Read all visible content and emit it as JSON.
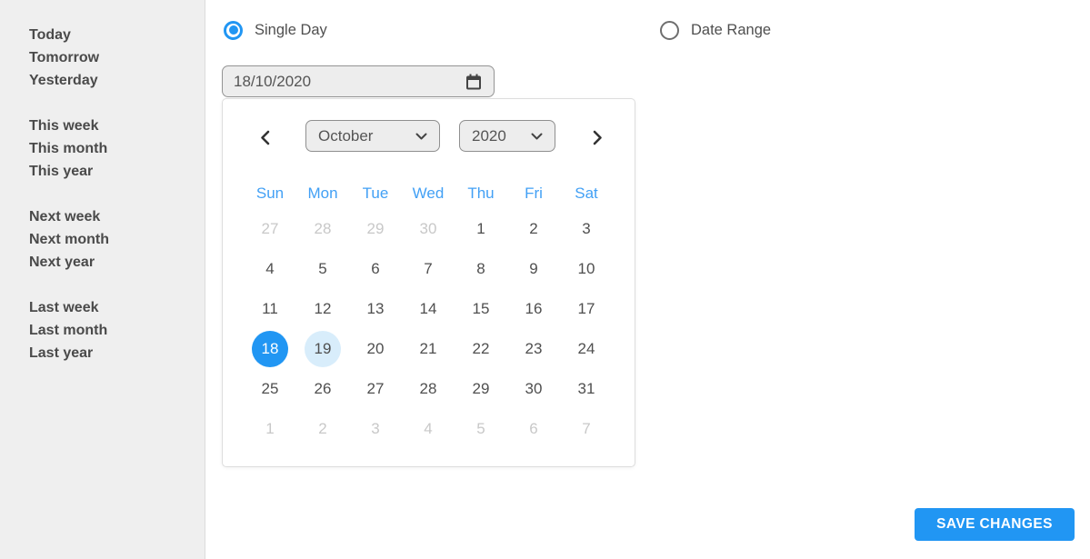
{
  "colors": {
    "accent": "#2196f3",
    "day_header": "#42a0f5",
    "highlight": "#d8edfb"
  },
  "sidebar": {
    "groups": [
      {
        "items": [
          {
            "label": "Today"
          },
          {
            "label": "Tomorrow"
          },
          {
            "label": "Yesterday"
          }
        ]
      },
      {
        "items": [
          {
            "label": "This week"
          },
          {
            "label": "This month"
          },
          {
            "label": "This year"
          }
        ]
      },
      {
        "items": [
          {
            "label": "Next week"
          },
          {
            "label": "Next month"
          },
          {
            "label": "Next year"
          }
        ]
      },
      {
        "items": [
          {
            "label": "Last week"
          },
          {
            "label": "Last month"
          },
          {
            "label": "Last year"
          }
        ]
      }
    ]
  },
  "mode": {
    "single_day": {
      "label": "Single Day",
      "selected": true
    },
    "date_range": {
      "label": "Date Range",
      "selected": false
    }
  },
  "date_field": {
    "value": "18/10/2020"
  },
  "calendar": {
    "month": "October",
    "year": "2020",
    "day_headers": [
      "Sun",
      "Mon",
      "Tue",
      "Wed",
      "Thu",
      "Fri",
      "Sat"
    ],
    "selected_day": 18,
    "highlighted_day": 19,
    "cells": [
      {
        "day": 27,
        "state": "muted"
      },
      {
        "day": 28,
        "state": "muted"
      },
      {
        "day": 29,
        "state": "muted"
      },
      {
        "day": 30,
        "state": "muted"
      },
      {
        "day": 1,
        "state": "normal"
      },
      {
        "day": 2,
        "state": "normal"
      },
      {
        "day": 3,
        "state": "normal"
      },
      {
        "day": 4,
        "state": "normal"
      },
      {
        "day": 5,
        "state": "normal"
      },
      {
        "day": 6,
        "state": "normal"
      },
      {
        "day": 7,
        "state": "normal"
      },
      {
        "day": 8,
        "state": "normal"
      },
      {
        "day": 9,
        "state": "normal"
      },
      {
        "day": 10,
        "state": "normal"
      },
      {
        "day": 11,
        "state": "normal"
      },
      {
        "day": 12,
        "state": "normal"
      },
      {
        "day": 13,
        "state": "normal"
      },
      {
        "day": 14,
        "state": "normal"
      },
      {
        "day": 15,
        "state": "normal"
      },
      {
        "day": 16,
        "state": "normal"
      },
      {
        "day": 17,
        "state": "normal"
      },
      {
        "day": 18,
        "state": "selected"
      },
      {
        "day": 19,
        "state": "highlighted"
      },
      {
        "day": 20,
        "state": "normal"
      },
      {
        "day": 21,
        "state": "normal"
      },
      {
        "day": 22,
        "state": "normal"
      },
      {
        "day": 23,
        "state": "normal"
      },
      {
        "day": 24,
        "state": "normal"
      },
      {
        "day": 25,
        "state": "normal"
      },
      {
        "day": 26,
        "state": "normal"
      },
      {
        "day": 27,
        "state": "normal"
      },
      {
        "day": 28,
        "state": "normal"
      },
      {
        "day": 29,
        "state": "normal"
      },
      {
        "day": 30,
        "state": "normal"
      },
      {
        "day": 31,
        "state": "normal"
      },
      {
        "day": 1,
        "state": "muted"
      },
      {
        "day": 2,
        "state": "muted"
      },
      {
        "day": 3,
        "state": "muted"
      },
      {
        "day": 4,
        "state": "muted"
      },
      {
        "day": 5,
        "state": "muted"
      },
      {
        "day": 6,
        "state": "muted"
      },
      {
        "day": 7,
        "state": "muted"
      }
    ]
  },
  "save_button": {
    "label": "SAVE CHANGES"
  }
}
